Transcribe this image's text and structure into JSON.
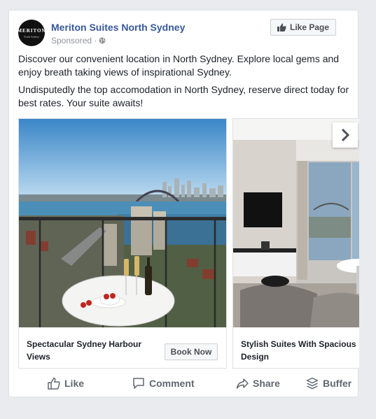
{
  "post": {
    "page_name": "Meriton Suites North Sydney",
    "sponsored": "Sponsored ·",
    "avatar_brand": "MERITON",
    "avatar_sub": "North Sydney",
    "like_page_label": "Like Page",
    "body_lines": [
      "Discover our convenient location in North Sydney. Explore local gems and enjoy breath taking views of inspirational Sydney.",
      "Undisputedly the top accomodation in North Sydney, reserve direct today for best rates. Your suite awaits!"
    ]
  },
  "carousel": {
    "cards": [
      {
        "title": "Spectacular Sydney Harbour Views",
        "cta": "Book Now"
      },
      {
        "title": "Stylish Suites With Spacious Design"
      }
    ],
    "next_icon": "chevron-right-icon"
  },
  "actions": {
    "like": "Like",
    "comment": "Comment",
    "share": "Share",
    "buffer": "Buffer"
  },
  "colors": {
    "link_blue": "#365899",
    "muted": "#90949c",
    "text": "#1d2129",
    "action_gray": "#606770"
  }
}
